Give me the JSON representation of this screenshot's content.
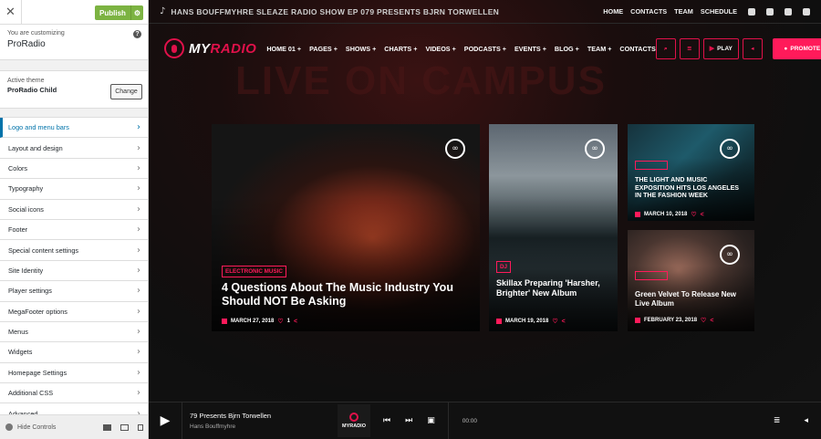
{
  "customizer": {
    "close_icon": "close-icon",
    "publish_label": "Publish",
    "customizing_label": "You are customizing",
    "site_name": "ProRadio",
    "active_theme_label": "Active theme",
    "theme_name": "ProRadio Child",
    "change_label": "Change",
    "sections": [
      "Logo and menu bars",
      "Layout and design",
      "Colors",
      "Typography",
      "Social icons",
      "Footer",
      "Special content settings",
      "Site Identity",
      "Player settings",
      "MegaFooter options",
      "Menus",
      "Widgets",
      "Homepage Settings",
      "Additional CSS",
      "Advanced"
    ],
    "hide_controls_label": "Hide Controls"
  },
  "preview": {
    "background_text": "LIVE ON CAMPUS",
    "now_playing": "HANS BOUFFMYHRE SLEAZE RADIO SHOW EP 079 PRESENTS BJRN TORWELLEN",
    "top_links": [
      "HOME",
      "CONTACTS",
      "TEAM",
      "SCHEDULE"
    ],
    "logo_my": "MY",
    "logo_radio": "RADIO",
    "menu": [
      "HOME 01 +",
      "PAGES +",
      "SHOWS +",
      "CHARTS +",
      "VIDEOS +",
      "PODCASTS +",
      "EVENTS +",
      "BLOG +",
      "TEAM +",
      "CONTACTS"
    ],
    "play_label": "PLAY",
    "promote_label": "PROMOTE",
    "accent": "#ff1a5a"
  },
  "cards": [
    {
      "tag": "ELECTRONIC MUSIC",
      "title": "4 Questions About The Music Industry You Should NOT Be Asking",
      "date": "MARCH 27, 2018",
      "likes": "1"
    },
    {
      "tag": "DJ",
      "title": "Skillax Preparing 'Harsher, Brighter' New Album",
      "date": "MARCH 19, 2018"
    },
    {
      "tag": "",
      "title": "THE LIGHT AND MUSIC EXPOSITION HITS LOS ANGELES IN THE FASHION WEEK",
      "date": "MARCH 10, 2018"
    },
    {
      "tag": "",
      "title": "Green Velvet To Release New Live Album",
      "date": "FEBRUARY 23, 2018"
    }
  ],
  "player": {
    "track": "79 Presents Bjrn Torwellen",
    "artist": "Hans Bouffmyhre",
    "cover_text": "MYRADIO",
    "time": "00:00"
  }
}
